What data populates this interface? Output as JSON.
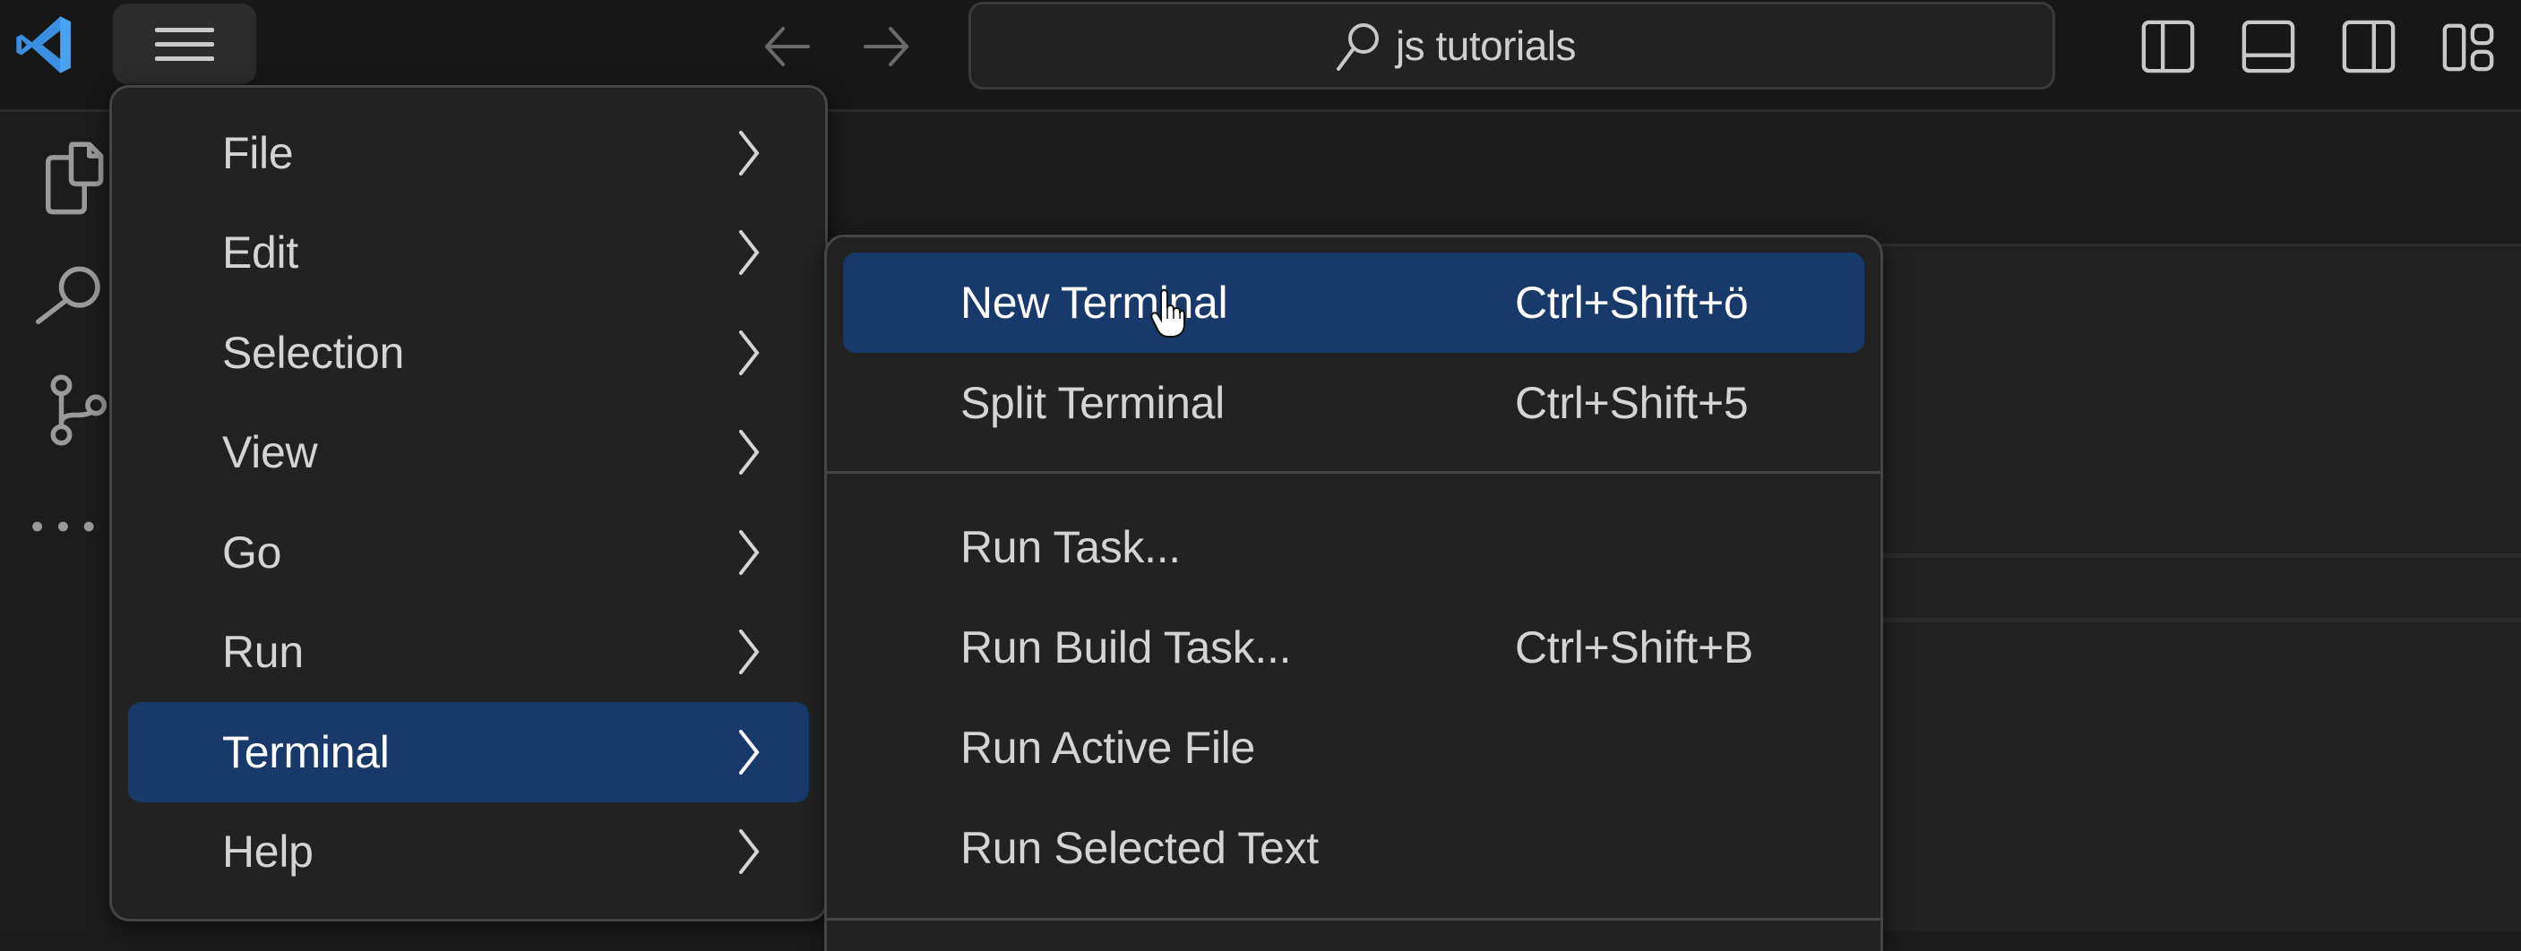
{
  "titlebar": {
    "logo_icon": "vscode-logo-icon",
    "menu_button_icon": "hamburger-menu-icon",
    "nav_back_icon": "arrow-left-icon",
    "nav_forward_icon": "arrow-right-icon",
    "command_center": {
      "icon": "search-icon",
      "text": "js tutorials"
    },
    "layout_controls": [
      {
        "name": "toggle-primary-sidebar",
        "icon": "layout-sidebar-left-icon"
      },
      {
        "name": "toggle-panel",
        "icon": "layout-panel-icon"
      },
      {
        "name": "toggle-secondary-sidebar",
        "icon": "layout-sidebar-right-icon"
      },
      {
        "name": "customize-layout",
        "icon": "layout-customize-icon"
      }
    ]
  },
  "activity_bar": {
    "items": [
      {
        "name": "explorer",
        "icon": "files-icon"
      },
      {
        "name": "search",
        "icon": "search-icon"
      },
      {
        "name": "source-control",
        "icon": "source-control-icon"
      },
      {
        "name": "more",
        "icon": "ellipsis-icon"
      }
    ]
  },
  "main_menu": {
    "items": [
      {
        "label": "File",
        "has_submenu": true
      },
      {
        "label": "Edit",
        "has_submenu": true
      },
      {
        "label": "Selection",
        "has_submenu": true
      },
      {
        "label": "View",
        "has_submenu": true
      },
      {
        "label": "Go",
        "has_submenu": true
      },
      {
        "label": "Run",
        "has_submenu": true
      },
      {
        "label": "Terminal",
        "has_submenu": true,
        "active": true
      },
      {
        "label": "Help",
        "has_submenu": true
      }
    ]
  },
  "terminal_submenu": {
    "group1": [
      {
        "label": "New Terminal",
        "shortcut": "Ctrl+Shift+ö",
        "active": true
      },
      {
        "label": "Split Terminal",
        "shortcut": "Ctrl+Shift+5"
      }
    ],
    "group2": [
      {
        "label": "Run Task...",
        "shortcut": ""
      },
      {
        "label": "Run Build Task...",
        "shortcut": "Ctrl+Shift+B"
      },
      {
        "label": "Run Active File",
        "shortcut": ""
      },
      {
        "label": "Run Selected Text",
        "shortcut": ""
      }
    ]
  },
  "colors": {
    "highlight": "#173a6a",
    "menu_bg": "#222222",
    "titlebar_bg": "#171717",
    "logo_blue": "#3b8fe0"
  }
}
